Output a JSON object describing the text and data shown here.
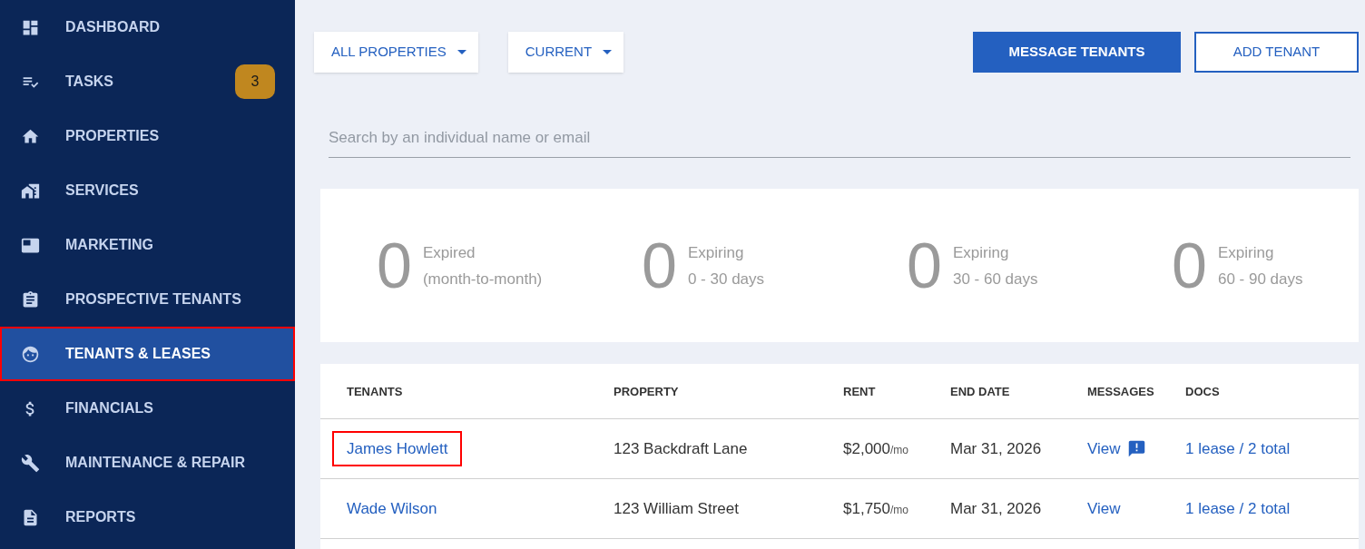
{
  "sidebar": {
    "items": [
      {
        "label": "DASHBOARD",
        "selected": false,
        "highlighted": false
      },
      {
        "label": "TASKS",
        "selected": false,
        "highlighted": false,
        "badge": "3"
      },
      {
        "label": "PROPERTIES",
        "selected": false,
        "highlighted": false
      },
      {
        "label": "SERVICES",
        "selected": false,
        "highlighted": false
      },
      {
        "label": "MARKETING",
        "selected": false,
        "highlighted": false
      },
      {
        "label": "PROSPECTIVE TENANTS",
        "selected": false,
        "highlighted": false
      },
      {
        "label": "TENANTS & LEASES",
        "selected": true,
        "highlighted": true
      },
      {
        "label": "FINANCIALS",
        "selected": false,
        "highlighted": false
      },
      {
        "label": "MAINTENANCE & REPAIR",
        "selected": false,
        "highlighted": false
      },
      {
        "label": "REPORTS",
        "selected": false,
        "highlighted": false
      }
    ]
  },
  "filters": [
    "ALL PROPERTIES",
    "CURRENT"
  ],
  "buttons": [
    {
      "label": "MESSAGE TENANTS",
      "kind": "primary"
    },
    {
      "label": "ADD TENANT",
      "kind": "outline"
    }
  ],
  "search": {
    "placeholder": "Search by an individual name or email"
  },
  "stats": [
    {
      "count": "0",
      "label": "Expired",
      "sublabel": "(month-to-month)"
    },
    {
      "count": "0",
      "label": "Expiring",
      "sublabel": "0 - 30 days"
    },
    {
      "count": "0",
      "label": "Expiring",
      "sublabel": "30 - 60 days"
    },
    {
      "count": "0",
      "label": "Expiring",
      "sublabel": "60 - 90 days"
    }
  ],
  "table": {
    "columns": [
      "TENANTS",
      "PROPERTY",
      "RENT",
      "END DATE",
      "MESSAGES",
      "DOCS"
    ],
    "rows": [
      {
        "tenant": "James Howlett",
        "highlighted": true,
        "property": "123 Backdraft Lane",
        "rent": "$2,000",
        "rent_unit": "/mo",
        "end_date": "Mar 31, 2026",
        "messages": "View",
        "unread": true,
        "docs": "1 lease / 2 total"
      },
      {
        "tenant": "Wade Wilson",
        "highlighted": false,
        "property": "123 William Street",
        "rent": "$1,750",
        "rent_unit": "/mo",
        "end_date": "Mar 31, 2026",
        "messages": "View",
        "unread": false,
        "docs": "1 lease / 2 total"
      }
    ]
  }
}
